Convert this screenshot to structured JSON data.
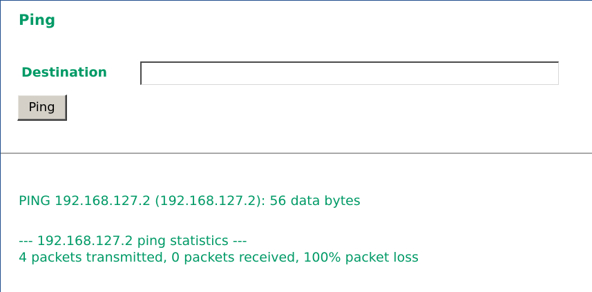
{
  "page": {
    "title": "Ping"
  },
  "form": {
    "destination_label": "Destination",
    "destination_value": "",
    "ping_button_label": "Ping"
  },
  "output": {
    "lines": [
      "PING 192.168.127.2 (192.168.127.2): 56 data bytes",
      "--- 192.168.127.2 ping statistics ---",
      "4 packets transmitted, 0 packets received, 100% packet loss"
    ]
  },
  "colors": {
    "text_accent": "#009a66",
    "frame_border": "#1f4e8c",
    "button_face": "#d4d0c8",
    "divider": "#a8a8a8"
  }
}
